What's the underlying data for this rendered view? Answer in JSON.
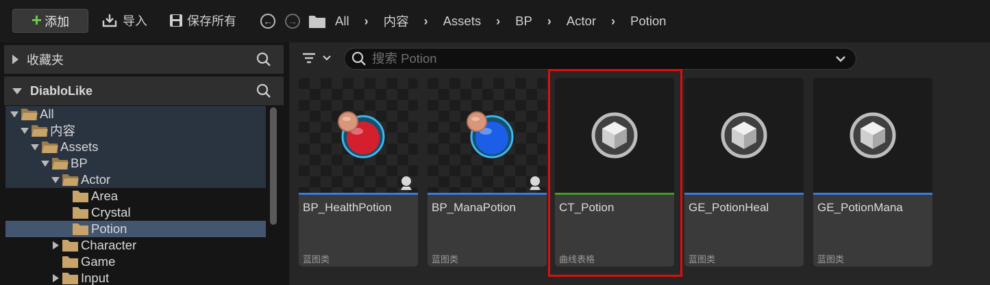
{
  "toolbar": {
    "add_label": "添加",
    "import_label": "导入",
    "save_all_label": "保存所有"
  },
  "breadcrumb": [
    "All",
    "内容",
    "Assets",
    "BP",
    "Actor",
    "Potion"
  ],
  "left_panel": {
    "favorites_label": "收藏夹",
    "project_label": "DiabloLike",
    "tree": [
      {
        "label": "All",
        "depth": 0,
        "expanded": true,
        "state": "hl"
      },
      {
        "label": "内容",
        "depth": 1,
        "expanded": true,
        "state": "hl"
      },
      {
        "label": "Assets",
        "depth": 2,
        "expanded": true,
        "state": "hl"
      },
      {
        "label": "BP",
        "depth": 3,
        "expanded": true,
        "state": "hl"
      },
      {
        "label": "Actor",
        "depth": 4,
        "expanded": true,
        "state": "hl"
      },
      {
        "label": "Area",
        "depth": 5,
        "expanded": null,
        "state": ""
      },
      {
        "label": "Crystal",
        "depth": 5,
        "expanded": null,
        "state": ""
      },
      {
        "label": "Potion",
        "depth": 5,
        "expanded": null,
        "state": "sel"
      },
      {
        "label": "Character",
        "depth": 4,
        "expanded": false,
        "state": ""
      },
      {
        "label": "Game",
        "depth": 4,
        "expanded": null,
        "state": ""
      },
      {
        "label": "Input",
        "depth": 4,
        "expanded": false,
        "state": ""
      }
    ]
  },
  "search": {
    "placeholder": "搜索 Potion",
    "value": ""
  },
  "assets": [
    {
      "name": "BP_HealthPotion",
      "type": "蓝图类",
      "bar_color": "#3c7be0",
      "thumb": "potion",
      "liquid": "#d4202e"
    },
    {
      "name": "BP_ManaPotion",
      "type": "蓝图类",
      "bar_color": "#3c7be0",
      "thumb": "potion",
      "liquid": "#1b5fe8"
    },
    {
      "name": "CT_Potion",
      "type": "曲线表格",
      "bar_color": "#4a9a2e",
      "thumb": "cube",
      "liquid": ""
    },
    {
      "name": "GE_PotionHeal",
      "type": "蓝图类",
      "bar_color": "#3c7be0",
      "thumb": "cube",
      "liquid": ""
    },
    {
      "name": "GE_PotionMana",
      "type": "蓝图类",
      "bar_color": "#3c7be0",
      "thumb": "cube",
      "liquid": ""
    }
  ],
  "colors": {
    "highlight_box": "#e00d0d",
    "add_plus": "#6fcb4b",
    "folder": "#c8a46a"
  }
}
